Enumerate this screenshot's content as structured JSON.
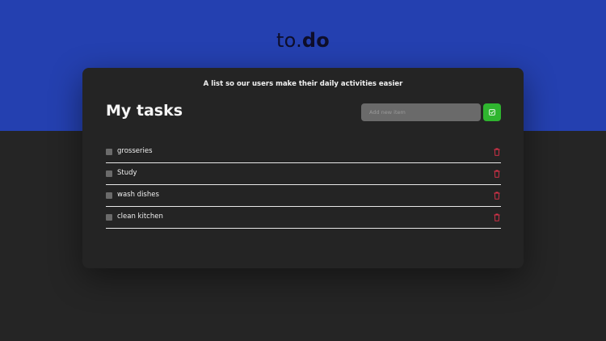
{
  "logo": {
    "prefix": "to.",
    "suffix": "do"
  },
  "card": {
    "subtitle": "A list so our users make their daily activities easier",
    "heading": "My tasks",
    "new_task": {
      "placeholder": "Add new item"
    },
    "add_icon": "check-square-icon",
    "delete_icon": "trash-icon"
  },
  "tasks": [
    {
      "label": "grosseries"
    },
    {
      "label": "Study"
    },
    {
      "label": "wash dishes"
    },
    {
      "label": "clean kitchen"
    }
  ],
  "colors": {
    "header_bg": "#2440b0",
    "page_bg": "#252525",
    "card_bg": "#242424",
    "accent_green": "#2fb52f",
    "delete_red": "#e0324a"
  }
}
